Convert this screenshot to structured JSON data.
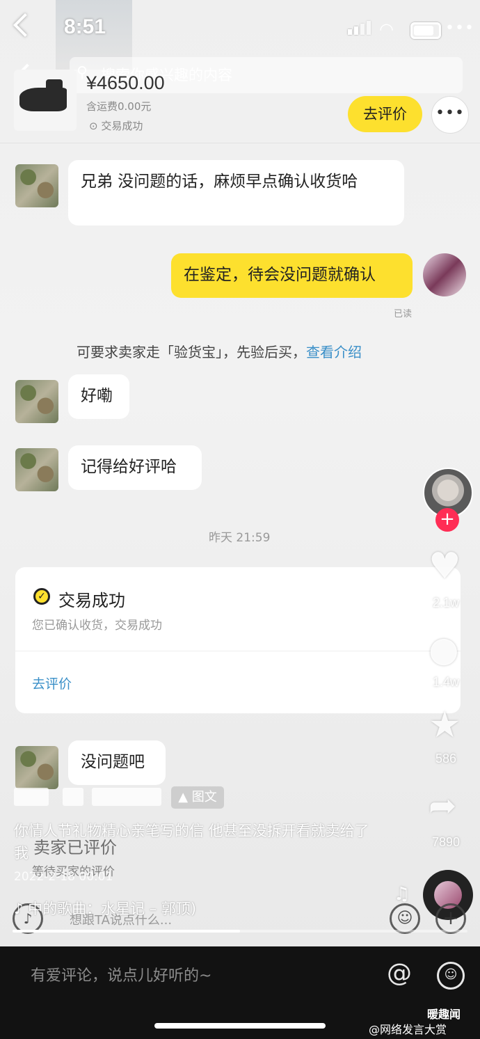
{
  "status_bar": {
    "time": "8:51"
  },
  "search": {
    "placeholder": "搜索你感兴趣的内容"
  },
  "product": {
    "price": "¥4650.00",
    "shipping": "含运费0.00元",
    "status": "交易成功",
    "review_button": "去评价"
  },
  "messages": [
    {
      "from": "other",
      "text": "兄弟 没问题的话，麻烦早点确认收货哈"
    },
    {
      "from": "me",
      "text": "在鉴定，待会没问题就确认",
      "read_label": "已读"
    },
    {
      "from": "other",
      "text": "好嘞"
    },
    {
      "from": "other",
      "text": "记得给好评哈"
    },
    {
      "from": "other",
      "text": "没问题吧"
    }
  ],
  "system_tip": {
    "text": "可要求卖家走「验货宝」，先验后买，",
    "link": "查看介绍"
  },
  "timestamp": "昨天 21:59",
  "deal_card": {
    "title": "交易成功",
    "subtitle": "您已确认收货，交易成功",
    "link": "去评价"
  },
  "seller_review": {
    "title": "卖家已评价",
    "subtitle": "等待买家的评价"
  },
  "chat_input_placeholder": "想跟TA说点什么...",
  "video": {
    "tag": "图文",
    "caption": "你情人节礼物精心亲笔写的信 他甚至没拆开看就卖给了我",
    "date": "2022-2-18 00:01",
    "music": "中的歌曲：水星记 – 郭顶)",
    "progress": 0.5,
    "likes": "2.1w",
    "comments": "1.4w",
    "favorites": "586",
    "shares": "7890"
  },
  "bottom_bar": {
    "comment_placeholder": "有爱评论，说点儿好听的~"
  },
  "watermark": {
    "line1": "暖趣闻",
    "line2": "@网络发言大赏"
  },
  "colors": {
    "accent_yellow": "#fde02e",
    "link_blue": "#3a8fc8",
    "follow_red": "#ff2d55"
  }
}
